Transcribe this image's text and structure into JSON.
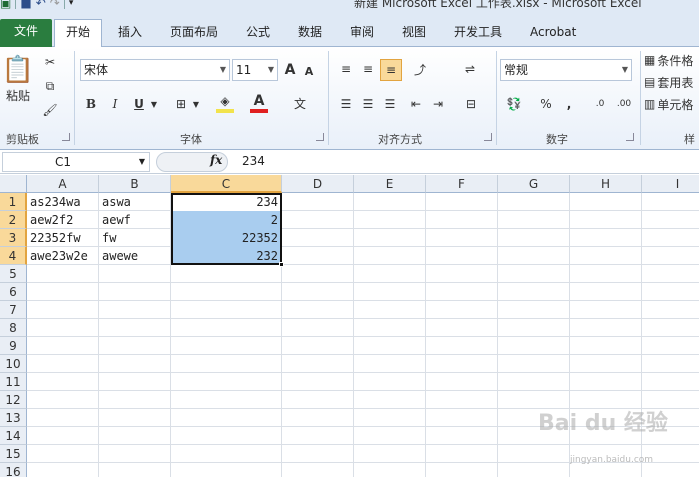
{
  "window": {
    "title": "新建 Microsoft Excel 工作表.xlsx  -  Microsoft Excel"
  },
  "tabs": [
    {
      "label": "文件"
    },
    {
      "label": "开始"
    },
    {
      "label": "插入"
    },
    {
      "label": "页面布局"
    },
    {
      "label": "公式"
    },
    {
      "label": "数据"
    },
    {
      "label": "审阅"
    },
    {
      "label": "视图"
    },
    {
      "label": "开发工具"
    },
    {
      "label": "Acrobat"
    }
  ],
  "ribbon": {
    "clipboard": {
      "paste": "粘贴",
      "label": "剪贴板"
    },
    "font": {
      "name": "宋体",
      "size": "11",
      "label": "字体",
      "bold": "B",
      "italic": "I",
      "underline": "U",
      "grow": "A",
      "shrink": "A",
      "color": "A"
    },
    "alignment": {
      "label": "对齐方式"
    },
    "number": {
      "format": "常规",
      "label": "数字",
      "percent": "%",
      "comma": ","
    },
    "styles": {
      "conditional": "条件格",
      "table": "套用表",
      "cell": "单元格",
      "label": "样"
    }
  },
  "formula_bar": {
    "name_box": "C1",
    "fx": "fx",
    "value": "234"
  },
  "grid": {
    "columns": [
      "A",
      "B",
      "C",
      "D",
      "E",
      "F",
      "G",
      "H",
      "I"
    ],
    "rows": [
      "1",
      "2",
      "3",
      "4",
      "5",
      "6",
      "7",
      "8",
      "9",
      "10",
      "11",
      "12",
      "13",
      "14",
      "15",
      "16"
    ],
    "cells": [
      {
        "a": "as234wa",
        "b": "aswa",
        "c": "234"
      },
      {
        "a": "aew2f2",
        "b": "aewf",
        "c": "2"
      },
      {
        "a": "22352fw",
        "b": "fw",
        "c": "22352"
      },
      {
        "a": "awe23w2e",
        "b": "awewe",
        "c": "232"
      }
    ]
  },
  "watermark": {
    "main": "Bai du 经验",
    "sub": "jingyan.baidu.com"
  },
  "colors": {
    "file_tab": "#2a7d3f",
    "selection": "#a9cdef",
    "header_selected": "#f9d99a"
  }
}
